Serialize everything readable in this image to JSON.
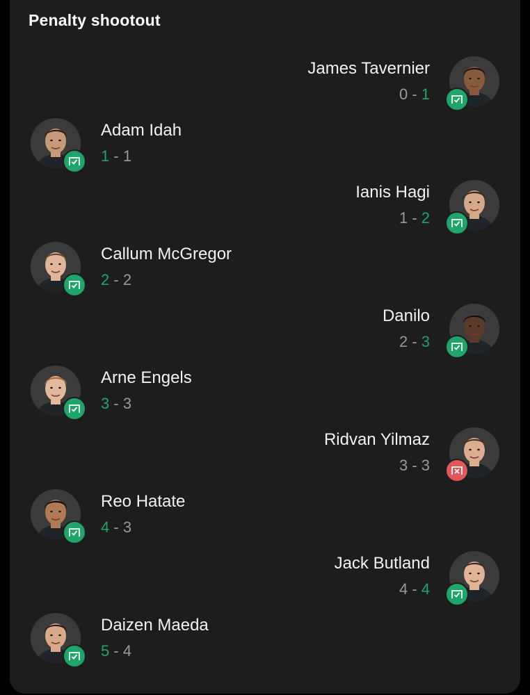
{
  "title": "Penalty shootout",
  "colors": {
    "card": "#1d1d1d",
    "scored": "#1fa46a",
    "missed": "#e05757",
    "muted": "#9a9a9a",
    "text": "#f2f2f2"
  },
  "kicks": [
    {
      "side": "right",
      "name": "James Tavernier",
      "home": "0",
      "away": "1",
      "result": "scored",
      "icon": "goal-check-icon"
    },
    {
      "side": "left",
      "name": "Adam Idah",
      "home": "1",
      "away": "1",
      "result": "scored",
      "icon": "goal-check-icon"
    },
    {
      "side": "right",
      "name": "Ianis Hagi",
      "home": "1",
      "away": "2",
      "result": "scored",
      "icon": "goal-check-icon"
    },
    {
      "side": "left",
      "name": "Callum McGregor",
      "home": "2",
      "away": "2",
      "result": "scored",
      "icon": "goal-check-icon"
    },
    {
      "side": "right",
      "name": "Danilo",
      "home": "2",
      "away": "3",
      "result": "scored",
      "icon": "goal-check-icon"
    },
    {
      "side": "left",
      "name": "Arne Engels",
      "home": "3",
      "away": "3",
      "result": "scored",
      "icon": "goal-check-icon"
    },
    {
      "side": "right",
      "name": "Ridvan Yilmaz",
      "home": "3",
      "away": "3",
      "result": "missed",
      "icon": "goal-cross-icon"
    },
    {
      "side": "left",
      "name": "Reo Hatate",
      "home": "4",
      "away": "3",
      "result": "scored",
      "icon": "goal-check-icon"
    },
    {
      "side": "right",
      "name": "Jack Butland",
      "home": "4",
      "away": "4",
      "result": "scored",
      "icon": "goal-check-icon"
    },
    {
      "side": "left",
      "name": "Daizen Maeda",
      "home": "5",
      "away": "4",
      "result": "scored",
      "icon": "goal-check-icon"
    }
  ]
}
